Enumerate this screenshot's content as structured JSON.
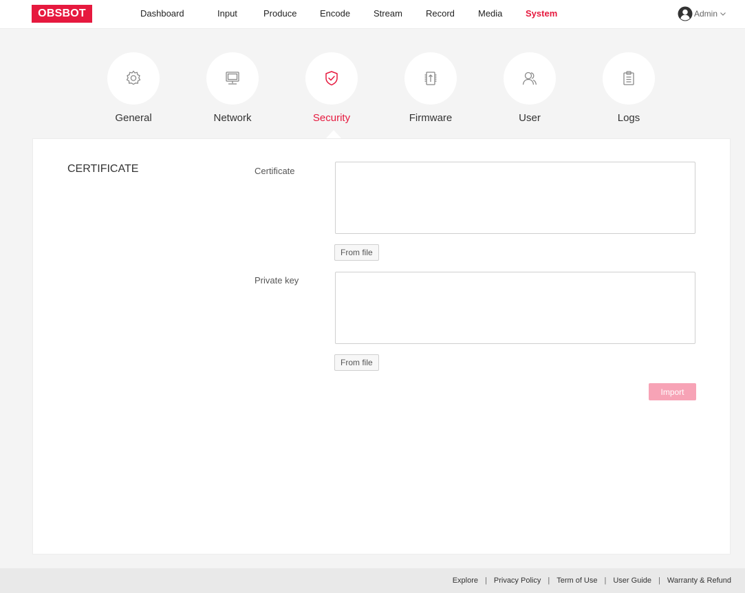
{
  "brand": {
    "logo_text": "OBSBOT",
    "accent": "#e6193e"
  },
  "nav": {
    "items": [
      {
        "label": "Dashboard",
        "active": false
      },
      {
        "label": "Input",
        "active": false
      },
      {
        "label": "Produce",
        "active": false
      },
      {
        "label": "Encode",
        "active": false
      },
      {
        "label": "Stream",
        "active": false
      },
      {
        "label": "Record",
        "active": false
      },
      {
        "label": "Media",
        "active": false
      },
      {
        "label": "System",
        "active": true
      }
    ],
    "user": {
      "name": "Admin",
      "icon": "user-avatar-icon"
    }
  },
  "categories": [
    {
      "label": "General",
      "icon": "gear-icon",
      "active": false
    },
    {
      "label": "Network",
      "icon": "monitor-icon",
      "active": false
    },
    {
      "label": "Security",
      "icon": "shield-check-icon",
      "active": true
    },
    {
      "label": "Firmware",
      "icon": "chip-upload-icon",
      "active": false
    },
    {
      "label": "User",
      "icon": "users-icon",
      "active": false
    },
    {
      "label": "Logs",
      "icon": "clipboard-icon",
      "active": false
    }
  ],
  "certificate": {
    "section_title": "CERTIFICATE",
    "certificate_label": "Certificate",
    "certificate_value": "",
    "certificate_button": "From file",
    "private_key_label": "Private key",
    "private_key_value": "",
    "private_key_button": "From file",
    "import_button": "Import",
    "import_color": "#f7a3b6"
  },
  "footer": {
    "links": [
      "Explore",
      "Privacy Policy",
      "Term of Use",
      "User Guide",
      "Warranty & Refund"
    ],
    "separator": "|"
  }
}
